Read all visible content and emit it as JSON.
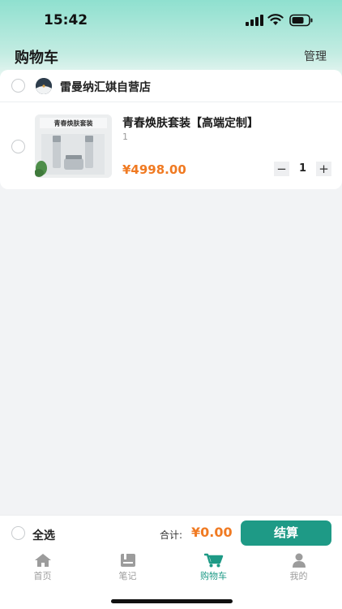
{
  "status_bar": {
    "time": "15:42"
  },
  "header": {
    "title": "购物车",
    "action_label": "管理"
  },
  "shop": {
    "name": "雷曼纳汇娸自营店"
  },
  "item": {
    "title": "青春焕肤套装【高端定制】",
    "spec": "1",
    "price": "¥4998.00",
    "quantity": "1",
    "thumb_text": "青春焕肤套装"
  },
  "footer": {
    "select_all_label": "全选",
    "total_label": "合计:",
    "total_value": "¥0.00",
    "checkout_label": "结算"
  },
  "tabs": [
    {
      "label": "首页",
      "icon": "home-icon"
    },
    {
      "label": "笔记",
      "icon": "notes-icon"
    },
    {
      "label": "购物车",
      "icon": "cart-icon",
      "active": true
    },
    {
      "label": "我的",
      "icon": "profile-icon"
    }
  ],
  "colors": {
    "accent": "#1e9a86",
    "price": "#f07a22",
    "header_gradient_top": "#8fe0cf"
  }
}
